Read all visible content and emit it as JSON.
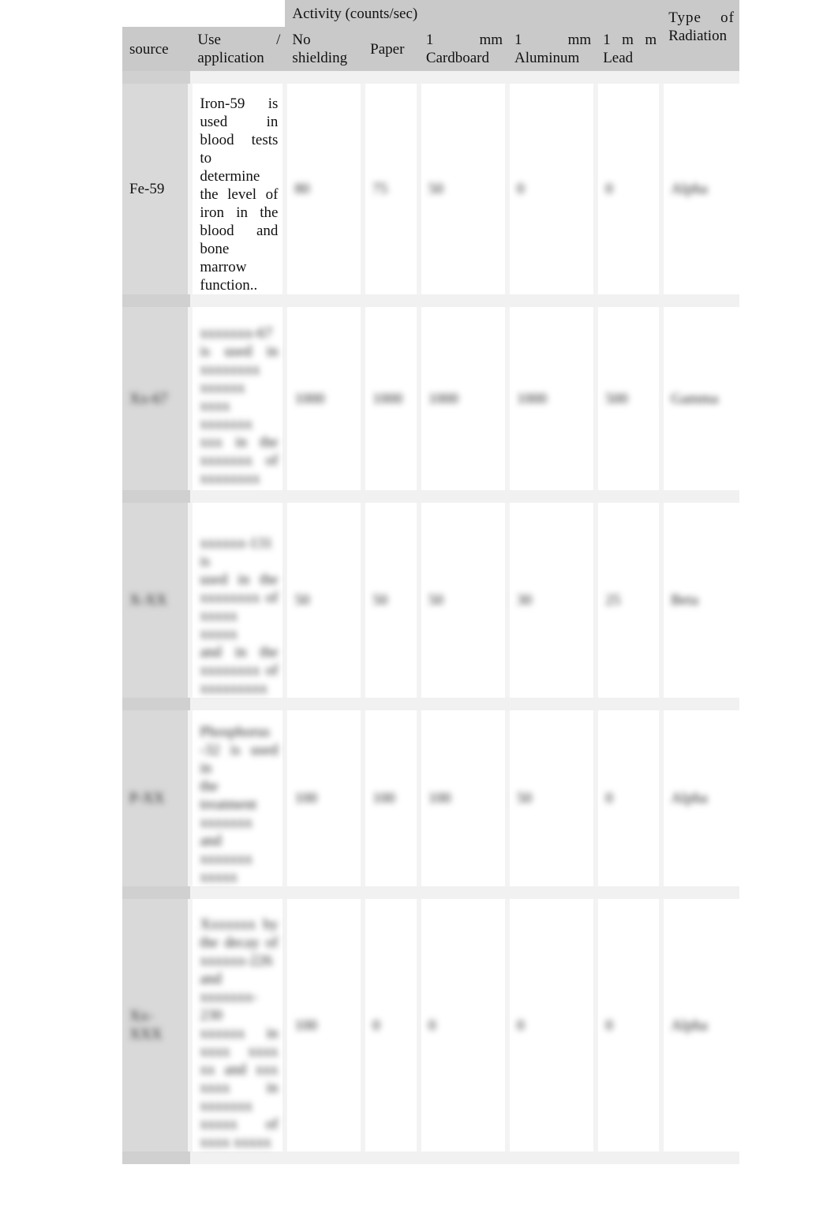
{
  "table": {
    "group_header": "Activity (counts/sec)",
    "headers": {
      "source": "source",
      "use_1": "Use",
      "use_slash": "/",
      "use_2": "application",
      "no_shield_1": "No",
      "no_shield_2": "shielding",
      "paper": "Paper",
      "cardboard_1": "1",
      "cardboard_mm": "mm",
      "cardboard_2": "Cardboard",
      "aluminum_1": "1",
      "aluminum_mm": "mm",
      "aluminum_2": "Aluminum",
      "lead_1": "1",
      "lead_mm": "m m",
      "lead_2": "Lead",
      "type_1": "Type",
      "type_of": "of",
      "type_2": "Radiation"
    },
    "rows": [
      {
        "source": "Fe-59",
        "use_lines": [
          "Iron-59 is",
          "used in",
          "blood tests to",
          "determine",
          "the level of",
          "iron in the",
          "blood and",
          "bone marrow",
          "function.."
        ],
        "no_shielding": "80",
        "paper": "75",
        "cardboard": "50",
        "aluminum": "0",
        "lead": "0",
        "type": "Alpha",
        "obscured": false
      },
      {
        "source": "Xx-67",
        "use_lines": [
          "xxxxxxx-67",
          "is used in",
          "xxxxxxxx",
          "xxxxxx",
          "xxxx",
          "xxxxxxx",
          "xxx in the",
          "xxxxxxx of",
          "xxxxxxxx"
        ],
        "no_shielding": "1000",
        "paper": "1000",
        "cardboard": "1000",
        "aluminum": "1000",
        "lead": "500",
        "type": "Gamma",
        "obscured": true
      },
      {
        "source": "X-XX",
        "use_lines": [
          "xxxxxx-131 is",
          "used in the",
          "xxxxxxxx of",
          "xxxxx xxxxx",
          "and in the",
          "xxxxxxxx of",
          "xxxxxxxxx"
        ],
        "no_shielding": "50",
        "paper": "50",
        "cardboard": "50",
        "aluminum": "30",
        "lead": "25",
        "type": "Beta",
        "obscured": true
      },
      {
        "source": "P-XX",
        "use_lines": [
          "Phosphorus",
          "-32 is used in",
          "the treatment",
          "xxxxxxx",
          "and",
          "xxxxxxx",
          "xxxxx"
        ],
        "no_shielding": "100",
        "paper": "100",
        "cardboard": "100",
        "aluminum": "50",
        "lead": "0",
        "type": "Alpha",
        "obscured": true
      },
      {
        "source": "Xx-XXX",
        "use_lines": [
          "Xxxxxxx by",
          "the decay of",
          "xxxxxx-226",
          "and",
          "xxxxxxx-230",
          "xxxxxx in",
          "xxxx xxxx",
          "xx and xxx",
          "xxxx in",
          "xxxxxxx",
          "xxxxx of",
          "xxxx xxxxx"
        ],
        "no_shielding": "100",
        "paper": "0",
        "cardboard": "0",
        "aluminum": "0",
        "lead": "0",
        "type": "Alpha",
        "obscured": true
      }
    ]
  }
}
